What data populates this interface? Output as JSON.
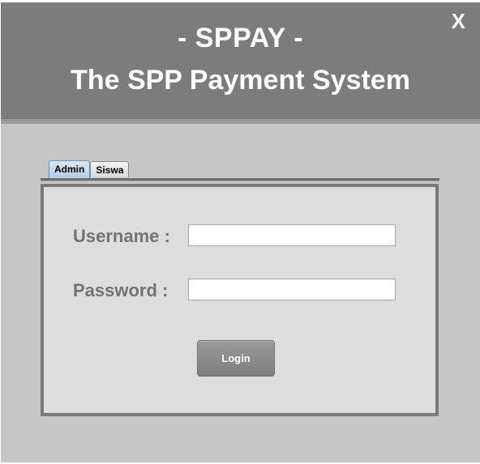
{
  "window": {
    "close_label": "X"
  },
  "header": {
    "title_line1": "- SPPAY -",
    "title_line2": "The SPP Payment System"
  },
  "tabs": [
    {
      "label": "Admin",
      "active": true
    },
    {
      "label": "Siswa",
      "active": false
    }
  ],
  "form": {
    "username_label": "Username :",
    "username_value": "",
    "password_label": "Password :",
    "password_value": "",
    "login_label": "Login"
  },
  "colors": {
    "header_bg": "#7c7c7c",
    "window_bg": "#c6c6c6",
    "panel_bg": "#dddddd",
    "label_text": "#737373",
    "active_tab": "#b4cde6"
  }
}
